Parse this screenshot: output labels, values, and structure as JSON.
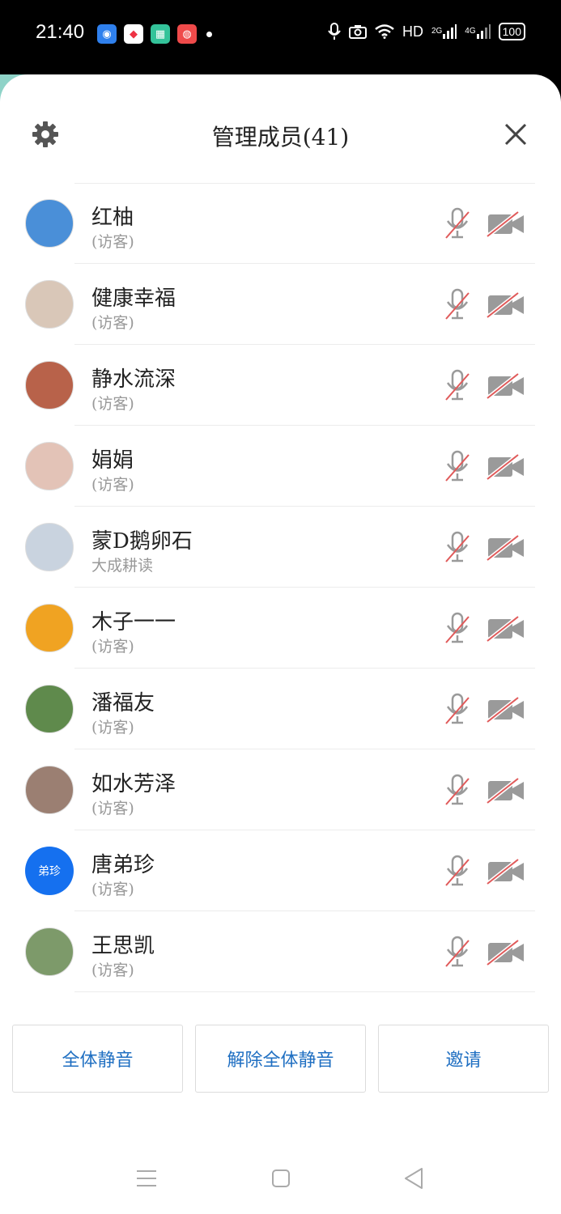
{
  "status_bar": {
    "time": "21:40",
    "right_label": "HD",
    "net1": "2G",
    "net2": "4G",
    "battery": "100"
  },
  "header": {
    "title": "管理成员(41)"
  },
  "members": [
    {
      "name": "红柚",
      "sub": "(访客)",
      "avatar_color": "#4a8fd8"
    },
    {
      "name": "健康幸福",
      "sub": "(访客)",
      "avatar_color": "#d9c7b8"
    },
    {
      "name": "静水流深",
      "sub": "(访客)",
      "avatar_color": "#b8624a"
    },
    {
      "name": "娟娟",
      "sub": "(访客)",
      "avatar_color": "#e3c3b7"
    },
    {
      "name": "蒙D鹅卵石",
      "sub": "大成耕读",
      "avatar_color": "#c9d3df"
    },
    {
      "name": "木子一一",
      "sub": "(访客)",
      "avatar_color": "#f0a322"
    },
    {
      "name": "潘福友",
      "sub": "(访客)",
      "avatar_color": "#5f8a4c"
    },
    {
      "name": "如水芳泽",
      "sub": "(访客)",
      "avatar_color": "#9b7f72"
    },
    {
      "name": "唐弟珍",
      "sub": "(访客)",
      "avatar_color": "#1570ef",
      "avatar_text": "弟珍"
    },
    {
      "name": "王思凯",
      "sub": "(访客)",
      "avatar_color": "#7d9a6a"
    }
  ],
  "actions": {
    "mute_all": "全体静音",
    "unmute_all": "解除全体静音",
    "invite": "邀请"
  },
  "colors": {
    "accent": "#1f6fc2",
    "muted_red": "#e05a5a",
    "icon_gray": "#9a9a9a"
  }
}
